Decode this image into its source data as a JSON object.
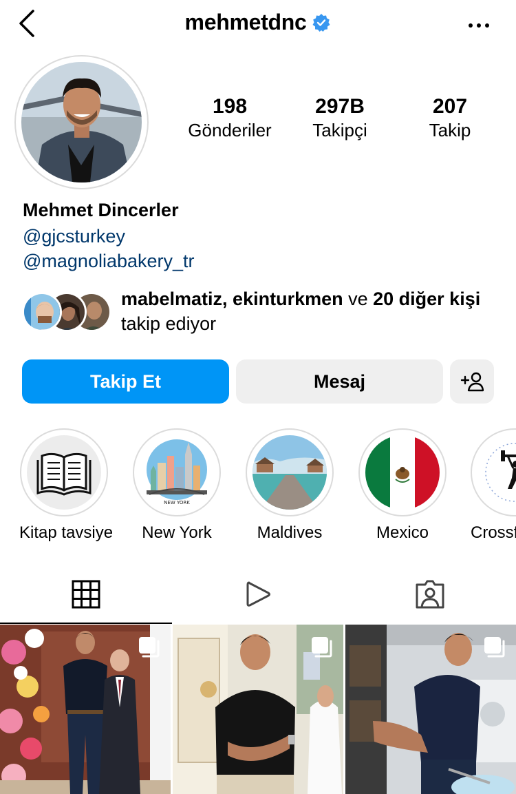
{
  "header": {
    "username": "mehmetdnc",
    "verified": true,
    "icons": {
      "back": "chevron-left-icon",
      "verified": "verified-badge-icon",
      "more": "more-horizontal-icon"
    }
  },
  "profile": {
    "full_name": "Mehmet Dincerler",
    "mentions": [
      "@gjcsturkey",
      "@magnoliabakery_tr"
    ],
    "stats": [
      {
        "value": "198",
        "label": "Gönderiler"
      },
      {
        "value": "297B",
        "label": "Takipçi"
      },
      {
        "value": "207",
        "label": "Takip"
      }
    ]
  },
  "followed_by": {
    "names": "mabelmatiz, ekinturkmen",
    "connector": " ve ",
    "others": "20 diğer kişi",
    "suffix": " takip ediyor"
  },
  "actions": {
    "follow_label": "Takip Et",
    "message_label": "Mesaj",
    "add_icon": "add-person-icon",
    "follow_color": "#0095f6"
  },
  "highlights": [
    {
      "label": "Kitap tavsiye",
      "icon": "open-book-icon"
    },
    {
      "label": "New York",
      "icon": "new-york-skyline-icon",
      "caption": "NEW YORK"
    },
    {
      "label": "Maldives",
      "icon": "maldives-pier-icon"
    },
    {
      "label": "Mexico",
      "icon": "mexico-flag-icon"
    },
    {
      "label": "Crossf",
      "icon": "crossfit-lifter-icon"
    }
  ],
  "tabs": [
    {
      "name": "grid",
      "icon": "grid-icon",
      "active": true
    },
    {
      "name": "reels",
      "icon": "reels-play-icon",
      "active": false
    },
    {
      "name": "tagged",
      "icon": "tagged-person-icon",
      "active": false
    }
  ],
  "posts": [
    {
      "scene": "flower wall event photo",
      "multi": true
    },
    {
      "scene": "bakery opening photo",
      "multi": true
    },
    {
      "scene": "kitchen cake photo",
      "multi": true
    }
  ]
}
